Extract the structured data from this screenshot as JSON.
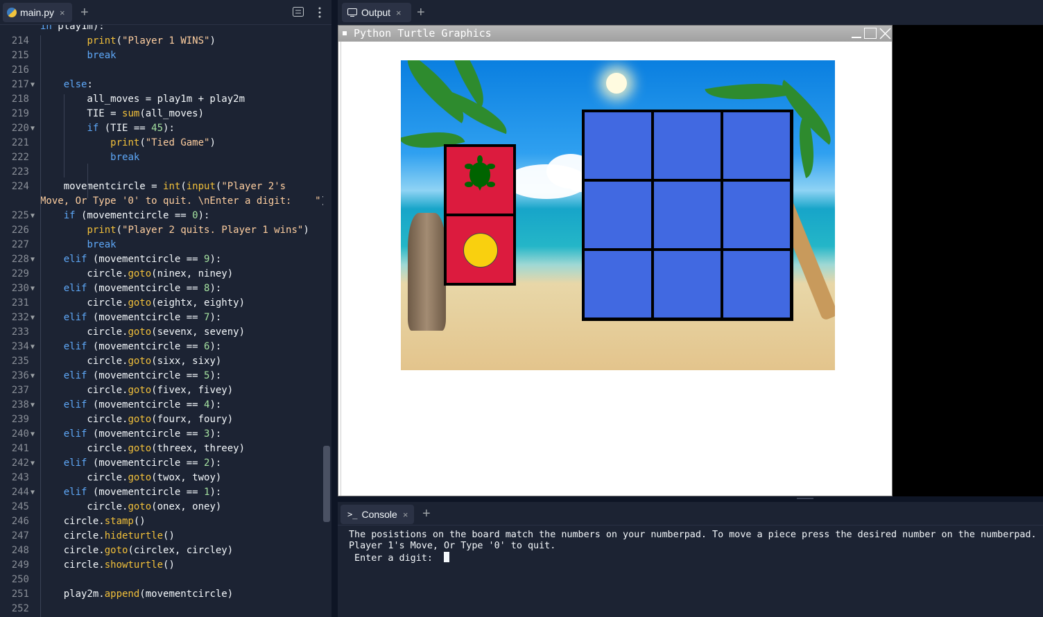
{
  "editor": {
    "tab_label": "main.py",
    "tab_close": "×",
    "add_tab": "+",
    "partial_top": "in play1m):",
    "lines": [
      {
        "n": "214",
        "fold": false,
        "tokens": [
          [
            "    ",
            ""
          ],
          [
            "print",
            "fn"
          ],
          [
            "(",
            ""
          ],
          [
            "\"Player 1 WINS\"",
            "str"
          ],
          [
            ")",
            ""
          ]
        ]
      },
      {
        "n": "215",
        "fold": false,
        "tokens": [
          [
            "    ",
            ""
          ],
          [
            "break",
            "kw"
          ]
        ]
      },
      {
        "n": "216",
        "fold": false,
        "tokens": []
      },
      {
        "n": "217",
        "fold": true,
        "tokens": [
          [
            "  ",
            ""
          ],
          [
            "else",
            "kw"
          ],
          [
            ":",
            ""
          ]
        ]
      },
      {
        "n": "218",
        "fold": false,
        "tokens": [
          [
            "    all_moves = play1m + play2m",
            ""
          ]
        ]
      },
      {
        "n": "219",
        "fold": false,
        "tokens": [
          [
            "    TIE = ",
            ""
          ],
          [
            "sum",
            "fn"
          ],
          [
            "(all_moves)",
            ""
          ]
        ]
      },
      {
        "n": "220",
        "fold": true,
        "tokens": [
          [
            "    ",
            ""
          ],
          [
            "if",
            "kw"
          ],
          [
            " (TIE == ",
            ""
          ],
          [
            "45",
            "num"
          ],
          [
            "):",
            ""
          ]
        ]
      },
      {
        "n": "221",
        "fold": false,
        "tokens": [
          [
            "      ",
            ""
          ],
          [
            "print",
            "fn"
          ],
          [
            "(",
            ""
          ],
          [
            "\"Tied Game\"",
            "str"
          ],
          [
            ")",
            ""
          ]
        ]
      },
      {
        "n": "222",
        "fold": false,
        "tokens": [
          [
            "      ",
            ""
          ],
          [
            "break",
            "kw"
          ]
        ]
      },
      {
        "n": "223",
        "fold": false,
        "tokens": []
      },
      {
        "n": "224",
        "fold": false,
        "tokens": [
          [
            "  movementcircle = ",
            ""
          ],
          [
            "int",
            "fn"
          ],
          [
            "(",
            ""
          ],
          [
            "input",
            "fn"
          ],
          [
            "(",
            ""
          ],
          [
            "\"Player 2's",
            "str"
          ]
        ]
      },
      {
        "n": "",
        "fold": false,
        "tokens": [
          [
            "Move, Or Type '0' to quit. \\nEnter a digit:  \"",
            "str"
          ],
          [
            "))",
            ""
          ]
        ],
        "wrap": true
      },
      {
        "n": "225",
        "fold": true,
        "tokens": [
          [
            "  ",
            ""
          ],
          [
            "if",
            "kw"
          ],
          [
            " (movementcircle == ",
            ""
          ],
          [
            "0",
            "num"
          ],
          [
            "):",
            ""
          ]
        ]
      },
      {
        "n": "226",
        "fold": false,
        "tokens": [
          [
            "    ",
            ""
          ],
          [
            "print",
            "fn"
          ],
          [
            "(",
            ""
          ],
          [
            "\"Player 2 quits. Player 1 wins\"",
            "str"
          ],
          [
            ")",
            ""
          ]
        ]
      },
      {
        "n": "227",
        "fold": false,
        "tokens": [
          [
            "    ",
            ""
          ],
          [
            "break",
            "kw"
          ]
        ]
      },
      {
        "n": "228",
        "fold": true,
        "tokens": [
          [
            "  ",
            ""
          ],
          [
            "elif",
            "kw"
          ],
          [
            " (movementcircle == ",
            ""
          ],
          [
            "9",
            "num"
          ],
          [
            "):",
            ""
          ]
        ]
      },
      {
        "n": "229",
        "fold": false,
        "tokens": [
          [
            "    circle.",
            ""
          ],
          [
            "goto",
            "fn"
          ],
          [
            "(ninex, niney)",
            ""
          ]
        ]
      },
      {
        "n": "230",
        "fold": true,
        "tokens": [
          [
            "  ",
            ""
          ],
          [
            "elif",
            "kw"
          ],
          [
            " (movementcircle == ",
            ""
          ],
          [
            "8",
            "num"
          ],
          [
            "):",
            ""
          ]
        ]
      },
      {
        "n": "231",
        "fold": false,
        "tokens": [
          [
            "    circle.",
            ""
          ],
          [
            "goto",
            "fn"
          ],
          [
            "(eightx, eighty)",
            ""
          ]
        ]
      },
      {
        "n": "232",
        "fold": true,
        "tokens": [
          [
            "  ",
            ""
          ],
          [
            "elif",
            "kw"
          ],
          [
            " (movementcircle == ",
            ""
          ],
          [
            "7",
            "num"
          ],
          [
            "):",
            ""
          ]
        ]
      },
      {
        "n": "233",
        "fold": false,
        "tokens": [
          [
            "    circle.",
            ""
          ],
          [
            "goto",
            "fn"
          ],
          [
            "(sevenx, seveny)",
            ""
          ]
        ]
      },
      {
        "n": "234",
        "fold": true,
        "tokens": [
          [
            "  ",
            ""
          ],
          [
            "elif",
            "kw"
          ],
          [
            " (movementcircle == ",
            ""
          ],
          [
            "6",
            "num"
          ],
          [
            "):",
            ""
          ]
        ]
      },
      {
        "n": "235",
        "fold": false,
        "tokens": [
          [
            "    circle.",
            ""
          ],
          [
            "goto",
            "fn"
          ],
          [
            "(sixx, sixy)",
            ""
          ]
        ]
      },
      {
        "n": "236",
        "fold": true,
        "tokens": [
          [
            "  ",
            ""
          ],
          [
            "elif",
            "kw"
          ],
          [
            " (movementcircle == ",
            ""
          ],
          [
            "5",
            "num"
          ],
          [
            "):",
            ""
          ]
        ]
      },
      {
        "n": "237",
        "fold": false,
        "tokens": [
          [
            "    circle.",
            ""
          ],
          [
            "goto",
            "fn"
          ],
          [
            "(fivex, fivey)",
            ""
          ]
        ]
      },
      {
        "n": "238",
        "fold": true,
        "tokens": [
          [
            "  ",
            ""
          ],
          [
            "elif",
            "kw"
          ],
          [
            " (movementcircle == ",
            ""
          ],
          [
            "4",
            "num"
          ],
          [
            "):",
            ""
          ]
        ]
      },
      {
        "n": "239",
        "fold": false,
        "tokens": [
          [
            "    circle.",
            ""
          ],
          [
            "goto",
            "fn"
          ],
          [
            "(fourx, foury)",
            ""
          ]
        ]
      },
      {
        "n": "240",
        "fold": true,
        "tokens": [
          [
            "  ",
            ""
          ],
          [
            "elif",
            "kw"
          ],
          [
            " (movementcircle == ",
            ""
          ],
          [
            "3",
            "num"
          ],
          [
            "):",
            ""
          ]
        ]
      },
      {
        "n": "241",
        "fold": false,
        "tokens": [
          [
            "    circle.",
            ""
          ],
          [
            "goto",
            "fn"
          ],
          [
            "(threex, threey)",
            ""
          ]
        ]
      },
      {
        "n": "242",
        "fold": true,
        "tokens": [
          [
            "  ",
            ""
          ],
          [
            "elif",
            "kw"
          ],
          [
            " (movementcircle == ",
            ""
          ],
          [
            "2",
            "num"
          ],
          [
            "):",
            ""
          ]
        ]
      },
      {
        "n": "243",
        "fold": false,
        "tokens": [
          [
            "    circle.",
            ""
          ],
          [
            "goto",
            "fn"
          ],
          [
            "(twox, twoy)",
            ""
          ]
        ]
      },
      {
        "n": "244",
        "fold": true,
        "tokens": [
          [
            "  ",
            ""
          ],
          [
            "elif",
            "kw"
          ],
          [
            " (movementcircle == ",
            ""
          ],
          [
            "1",
            "num"
          ],
          [
            "):",
            ""
          ]
        ]
      },
      {
        "n": "245",
        "fold": false,
        "tokens": [
          [
            "    circle.",
            ""
          ],
          [
            "goto",
            "fn"
          ],
          [
            "(onex, oney)",
            ""
          ]
        ]
      },
      {
        "n": "246",
        "fold": false,
        "tokens": [
          [
            "  circle.",
            ""
          ],
          [
            "stamp",
            "fn"
          ],
          [
            "()",
            ""
          ]
        ]
      },
      {
        "n": "247",
        "fold": false,
        "tokens": [
          [
            "  circle.",
            ""
          ],
          [
            "hideturtle",
            "fn"
          ],
          [
            "()",
            ""
          ]
        ]
      },
      {
        "n": "248",
        "fold": false,
        "tokens": [
          [
            "  circle.",
            ""
          ],
          [
            "goto",
            "fn"
          ],
          [
            "(circlex, circley)",
            ""
          ]
        ]
      },
      {
        "n": "249",
        "fold": false,
        "tokens": [
          [
            "  circle.",
            ""
          ],
          [
            "showturtle",
            "fn"
          ],
          [
            "()",
            ""
          ]
        ]
      },
      {
        "n": "250",
        "fold": false,
        "tokens": []
      },
      {
        "n": "251",
        "fold": false,
        "tokens": [
          [
            "  play2m.",
            ""
          ],
          [
            "append",
            "fn"
          ],
          [
            "(movementcircle)",
            ""
          ]
        ]
      }
    ],
    "partial_bottom_number": "252"
  },
  "output": {
    "tab_label": "Output",
    "tab_close": "×",
    "add_tab": "+",
    "window_title": "Python Turtle Graphics",
    "legend": {
      "turtle_color": "#006400",
      "circle_color": "#f9d00f",
      "cell_color": "#dc1b3e"
    },
    "board": {
      "rows": 3,
      "cols": 3,
      "cell_color": "#4169e1"
    }
  },
  "console": {
    "tab_label": "Console",
    "tab_close": "×",
    "add_tab": "+",
    "lines": [
      "The posistions on the board match the numbers on your numberpad. To move a piece press the desired number on the numberpad.",
      "Player 1's Move, Or Type '0' to quit.",
      " Enter a digit:  "
    ]
  }
}
